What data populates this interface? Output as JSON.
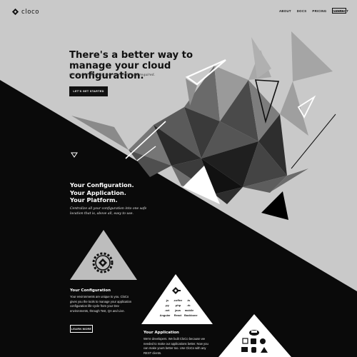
{
  "header": {
    "logo_text": "cloco",
    "nav": [
      "ABOUT",
      "DOCS",
      "PRICING",
      "CONTACT"
    ],
    "login_label": "LOGIN"
  },
  "hero": {
    "title": "There's a better way to manage your cloud configuration.",
    "subtitle": "Get started today for free - no credit card required.",
    "cta_label": "LET'S GET STARTED"
  },
  "tagline": {
    "title_lines": [
      "Your Configuration.",
      "Your Application.",
      "Your Platform."
    ],
    "description": "Centralize all your configuration into one safe location that is, above all, easy to use."
  },
  "configuration": {
    "title": "Your Configuration",
    "text": "Your environments are unique to you. CloCo gives you the tools to manage your application configuration life-cycle from your Dev environments, through Test, QA and Live.",
    "button_label": "LEARN MORE"
  },
  "application": {
    "title": "Your Application",
    "text": "We're developers. We built CloCo because we needed to make our applications better. Now you can make yours better too. Use CloCo with any REST clients."
  },
  "tech_grid": [
    [
      ".js",
      ".coffee",
      ".ts"
    ],
    [
      ".py",
      ".php",
      ".rb"
    ],
    [
      ".net",
      "java",
      "mobile"
    ],
    [
      "Angular",
      "React",
      "Backbone"
    ]
  ],
  "colors": {
    "background_light": "#c9c9c9",
    "background_dark": "#0a0a0a",
    "text_dark": "#111111",
    "text_light": "#ffffff"
  },
  "icons": [
    "cloco-logo-icon",
    "gear-logo-icon",
    "cloco-logo-small-icon",
    "platform-icons-cluster"
  ]
}
